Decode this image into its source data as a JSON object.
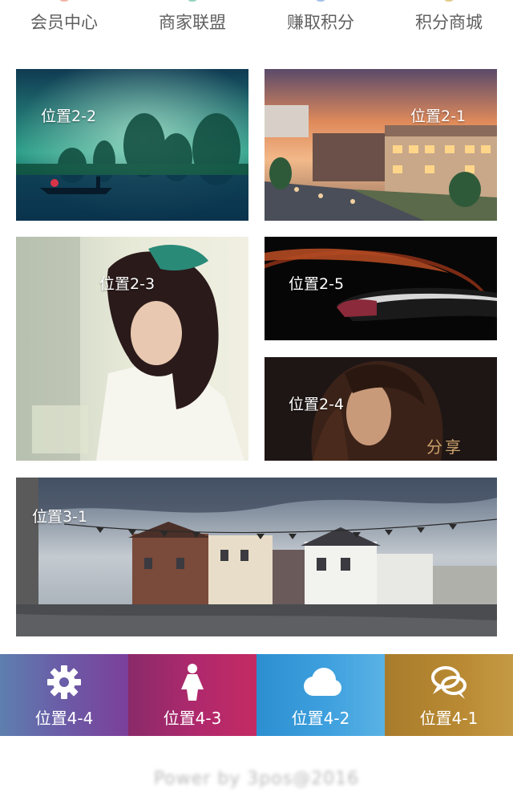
{
  "topnav": {
    "items": [
      {
        "label": "会员中心"
      },
      {
        "label": "商家联盟"
      },
      {
        "label": "赚取积分"
      },
      {
        "label": "积分商城"
      }
    ]
  },
  "tiles": {
    "t22": {
      "caption": "位置2-2"
    },
    "t21": {
      "caption": "位置2-1"
    },
    "t23": {
      "caption": "位置2-3"
    },
    "t25": {
      "caption": "位置2-5"
    },
    "t24": {
      "caption": "位置2-4",
      "stamp": "分享"
    },
    "t31": {
      "caption": "位置3-1"
    }
  },
  "bottombar": {
    "items": [
      {
        "label": "位置4-4",
        "icon": "gear-icon",
        "color": "#6a5ea8"
      },
      {
        "label": "位置4-3",
        "icon": "person-icon",
        "color": "#b0296c"
      },
      {
        "label": "位置4-2",
        "icon": "cloud-icon",
        "color": "#3ea0de"
      },
      {
        "label": "位置4-1",
        "icon": "chat-bubbles-icon",
        "color": "#b98a33"
      }
    ]
  },
  "footer": {
    "text": "Power by 3pos@2016"
  }
}
